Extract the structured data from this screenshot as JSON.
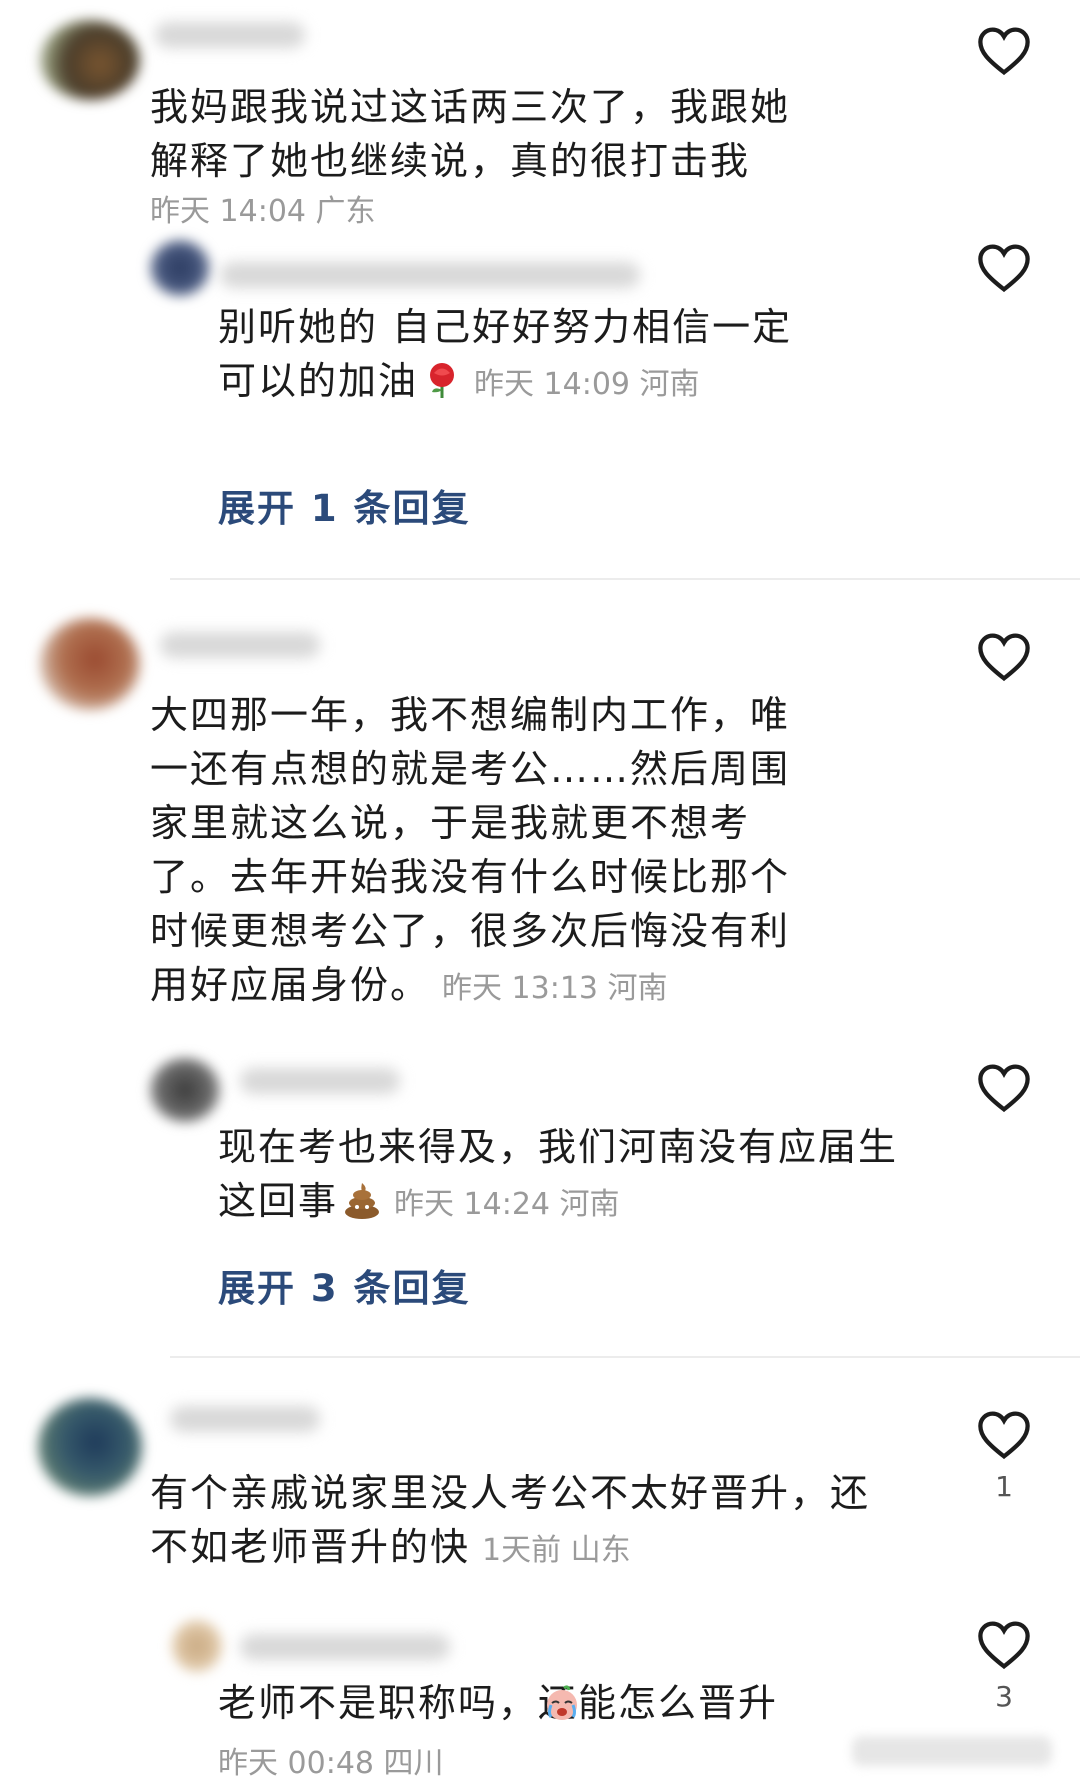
{
  "comments": [
    {
      "text": "我妈跟我说过这话两三次了，我跟她解释了她也继续说，真的很打击我",
      "meta": "昨天 14:04 广东",
      "reply": {
        "text": "别听她的 自己好好努力相信一定可以的加油",
        "meta": "昨天 14:09 河南",
        "emoji": "rose"
      },
      "expand": "展开 1 条回复"
    },
    {
      "text": "大四那一年，我不想编制内工作，唯一还有点想的就是考公……然后周围家里就这么说，于是我就更不想考了。去年开始我没有什么时候比那个时候更想考公了，很多次后悔没有利用好应届身份。",
      "meta": "昨天 13:13 河南",
      "reply": {
        "text": "现在考也来得及，我们河南没有应届生这回事",
        "meta": "昨天 14:24 河南",
        "emoji": "poop"
      },
      "expand": "展开 3 条回复"
    },
    {
      "text": "有个亲戚说家里没人考公不太好晋升，还不如老师晋升的快",
      "meta": "1天前  山东",
      "like_count": "1",
      "reply": {
        "text": "老师不是职称吗，还能怎么晋升",
        "meta": "昨天 00:48 四川",
        "emoji": "crying",
        "like_count": "3"
      }
    }
  ],
  "icons": {
    "like": "heart-outline-icon"
  },
  "colors": {
    "text": "#1c1c1c",
    "meta": "#9a9a9a",
    "expand": "#2b4a7a",
    "divider": "#ececec"
  }
}
